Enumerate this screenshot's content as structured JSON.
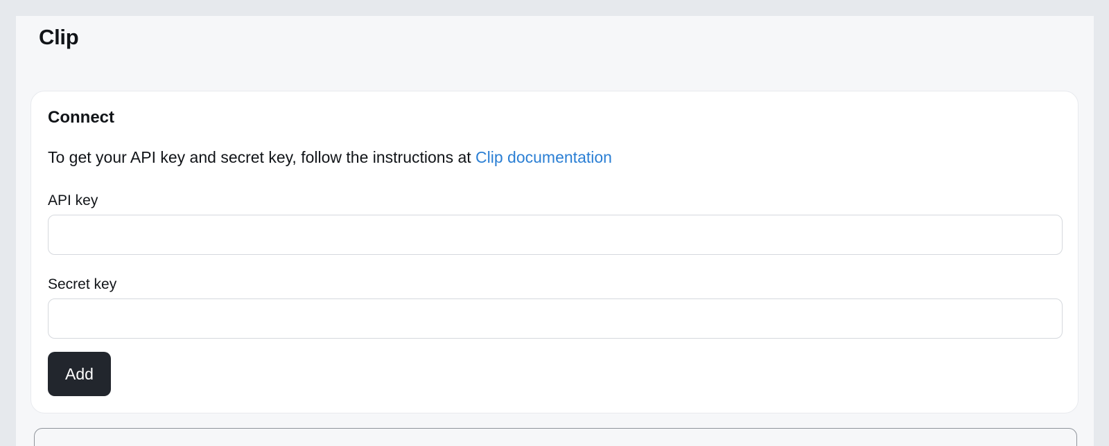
{
  "page": {
    "title": "Clip"
  },
  "connect_card": {
    "title": "Connect",
    "instructions_prefix": "To get your API key and secret key, follow the instructions at ",
    "doc_link_label": "Clip documentation",
    "api_key": {
      "label": "API key",
      "value": "",
      "placeholder": ""
    },
    "secret_key": {
      "label": "Secret key",
      "value": "",
      "placeholder": ""
    },
    "add_label": "Add"
  },
  "colors": {
    "page_background": "#f6f7f9",
    "card_background": "#ffffff",
    "link": "#2b7fd4",
    "primary_button": "#22262d"
  }
}
